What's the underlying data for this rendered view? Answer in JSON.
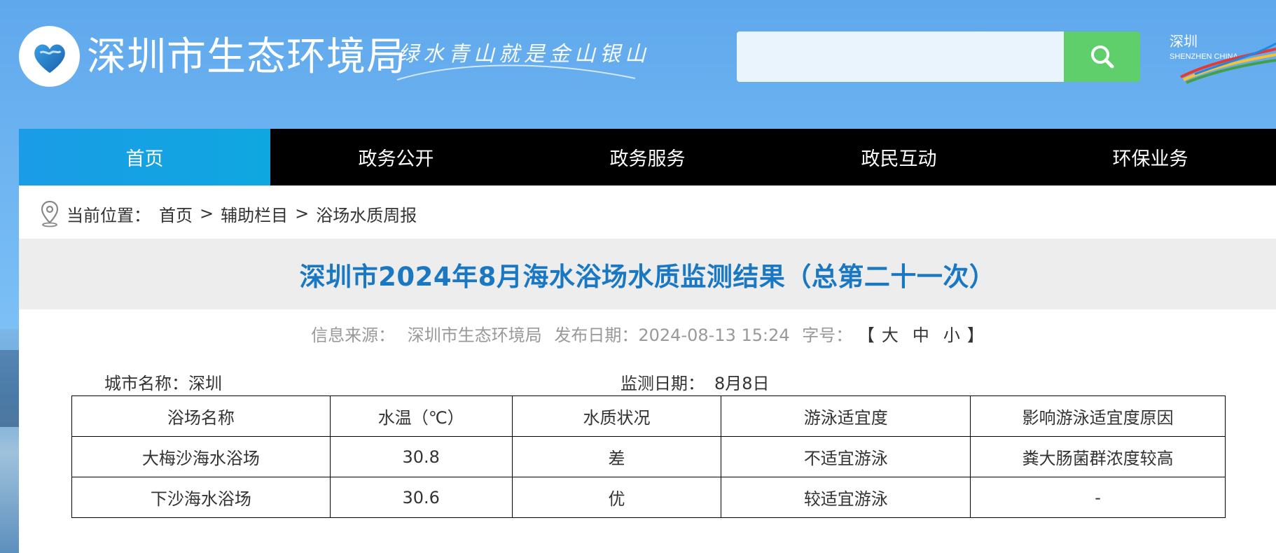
{
  "header": {
    "site_title": "深圳市生态环境局",
    "slogan": "绿水青山就是金山银山",
    "search_placeholder": "",
    "search_icon": "search-icon",
    "accent_color": "#5fcf6b",
    "city_logo_text_cn": "深圳",
    "city_logo_text_en": "SHENZHEN CHINA"
  },
  "nav": {
    "items": [
      {
        "label": "首页",
        "active": true
      },
      {
        "label": "政务公开",
        "active": false
      },
      {
        "label": "政务服务",
        "active": false
      },
      {
        "label": "政民互动",
        "active": false
      },
      {
        "label": "环保业务",
        "active": false
      }
    ]
  },
  "breadcrumb": {
    "prefix": "当前位置：",
    "items": [
      "首页",
      "辅助栏目",
      "浴场水质周报"
    ],
    "separator": ">"
  },
  "article": {
    "title": "深圳市2024年8月海水浴场水质监测结果（总第二十一次）",
    "source_label": "信息来源：",
    "source_value": "深圳市生态环境局",
    "date_label": "发布日期：",
    "date_value": "2024-08-13 15:24",
    "font_label": "字号：",
    "font_open": "【",
    "font_large": "大",
    "font_medium": "中",
    "font_small": "小",
    "font_close": "】",
    "city_label": "城市名称：",
    "city_value": "深圳",
    "monitor_label": "监测日期：",
    "monitor_value": "8月8日"
  },
  "table": {
    "headers": [
      "浴场名称",
      "水温（℃）",
      "水质状况",
      "游泳适宜度",
      "影响游泳适宜度原因"
    ],
    "rows": [
      [
        "大梅沙海水浴场",
        "30.8",
        "差",
        "不适宜游泳",
        "粪大肠菌群浓度较高"
      ],
      [
        "下沙海水浴场",
        "30.6",
        "优",
        "较适宜游泳",
        "-"
      ]
    ]
  }
}
